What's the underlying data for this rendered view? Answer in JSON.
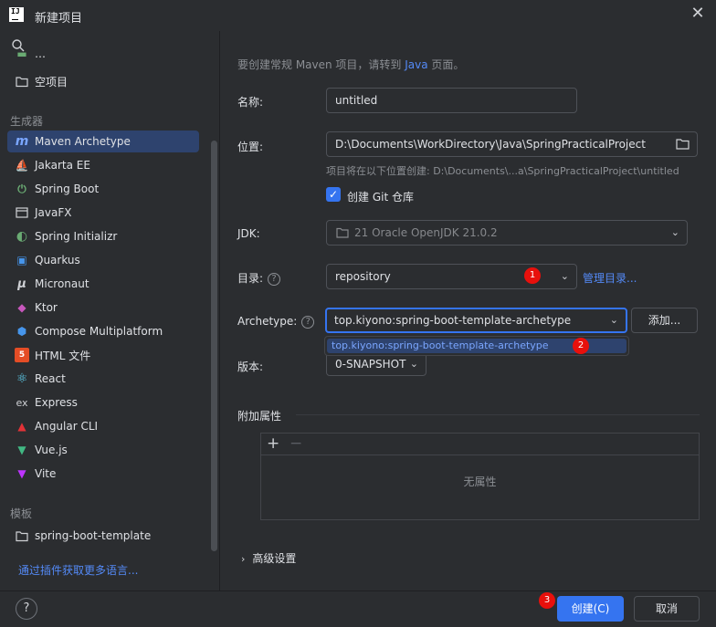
{
  "window": {
    "title": "新建项目",
    "logo_text": "IJ"
  },
  "sidebar": {
    "partial_item": "…",
    "empty_project": "空项目",
    "generators_header": "生成器",
    "generators": [
      {
        "label": "Maven Archetype",
        "icon": "maven-archetype-icon",
        "selected": true
      },
      {
        "label": "Jakarta EE",
        "icon": "jakarta-ee-icon"
      },
      {
        "label": "Spring Boot",
        "icon": "spring-boot-icon"
      },
      {
        "label": "JavaFX",
        "icon": "javafx-icon"
      },
      {
        "label": "Spring Initializr",
        "icon": "spring-initializr-icon"
      },
      {
        "label": "Quarkus",
        "icon": "quarkus-icon"
      },
      {
        "label": "Micronaut",
        "icon": "micronaut-icon"
      },
      {
        "label": "Ktor",
        "icon": "ktor-icon"
      },
      {
        "label": "Compose Multiplatform",
        "icon": "compose-icon"
      },
      {
        "label": "HTML 文件",
        "icon": "html-icon"
      },
      {
        "label": "React",
        "icon": "react-icon"
      },
      {
        "label": "Express",
        "icon": "express-icon"
      },
      {
        "label": "Angular CLI",
        "icon": "angular-icon"
      },
      {
        "label": "Vue.js",
        "icon": "vue-icon"
      },
      {
        "label": "Vite",
        "icon": "vite-icon"
      }
    ],
    "templates_header": "模板",
    "templates": [
      {
        "label": "spring-boot-template",
        "icon": "folder-icon"
      }
    ],
    "plugin_link": "通过插件获取更多语言..."
  },
  "form": {
    "hint_prefix": "要创建常规 Maven 项目，请转到 ",
    "hint_link": "Java",
    "hint_suffix": " 页面。",
    "name_label": "名称:",
    "name_value": "untitled",
    "location_label": "位置:",
    "location_value": "D:\\Documents\\WorkDirectory\\Java\\SpringPracticalProject",
    "location_hint": "项目将在以下位置创建: D:\\Documents\\...a\\SpringPracticalProject\\untitled",
    "git_label": "创建 Git 仓库",
    "git_checked": true,
    "jdk_label": "JDK:",
    "jdk_value": "21 Oracle OpenJDK 21.0.2",
    "catalog_label": "目录:",
    "catalog_value": "repository",
    "catalog_manage": "管理目录...",
    "archetype_label": "Archetype:",
    "archetype_value": "top.kiyono:spring-boot-template-archetype",
    "archetype_add": "添加...",
    "archetype_option": "top.kiyono:spring-boot-template-archetype",
    "version_label": "版本:",
    "version_value": "0-SNAPSHOT",
    "extra_props_title": "附加属性",
    "extra_props_empty": "无属性",
    "advanced_title": "高级设置"
  },
  "badges": {
    "b1": "1",
    "b2": "2",
    "b3": "3",
    "color": "#e8100c"
  },
  "buttons": {
    "create": "创建(C)",
    "cancel": "取消",
    "help": "?"
  },
  "colors": {
    "accent": "#3574f0",
    "link": "#548af7",
    "selection": "#2e436e",
    "background": "#2b2d30"
  }
}
